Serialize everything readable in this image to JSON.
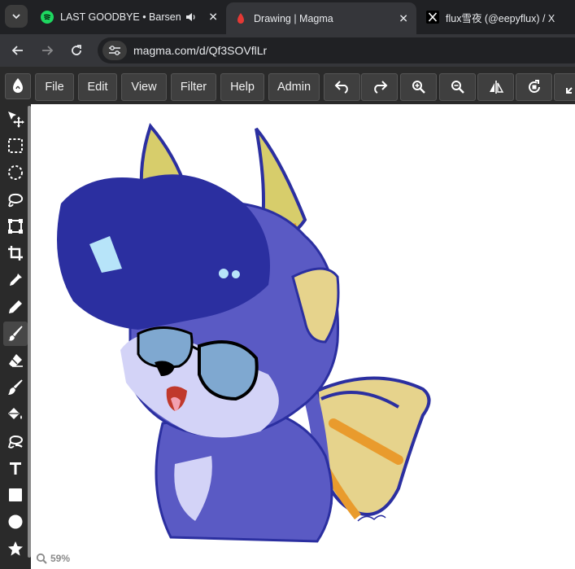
{
  "browser": {
    "tabs": [
      {
        "title": "LAST GOODBYE • Barsena B",
        "favicon": "spotify-icon",
        "audio": true
      },
      {
        "title": "Drawing | Magma",
        "favicon": "magma-icon",
        "active": true
      },
      {
        "title": "flux雪夜 (@eepyflux) / X",
        "favicon": "x-icon"
      }
    ],
    "url": "magma.com/d/Qf3SOVflLr"
  },
  "app": {
    "menu": {
      "file": "File",
      "edit": "Edit",
      "view": "View",
      "filter": "Filter",
      "help": "Help",
      "admin": "Admin"
    },
    "toolbar_icons": [
      "undo-icon",
      "redo-icon",
      "zoom-in-icon",
      "zoom-out-icon",
      "flip-icon",
      "rotate-icon",
      "fullscreen-icon"
    ],
    "tools": [
      "move-tool",
      "rectangle-select-tool",
      "ellipse-select-tool",
      "lasso-tool",
      "transform-tool",
      "crop-tool",
      "eyedropper-tool",
      "pencil-tool",
      "brush-tool",
      "eraser-tool",
      "smudge-tool",
      "fill-tool",
      "text-tool",
      "rectangle-tool",
      "ellipse-tool",
      "shape-tool"
    ],
    "active_tool": "brush-tool",
    "zoom": "59%"
  },
  "colors": {
    "chrome_bg": "#202124",
    "chrome_active": "#35363a",
    "app_bg": "#2a2a2a",
    "button_bg": "#3f3f3f",
    "canvas_bg": "#ffffff",
    "hair": "#2b2fa0",
    "fur": "#5a5ac4",
    "muzzle": "#d3d3f7",
    "horn": "#d7cd6b",
    "wing": "#e6d38c",
    "orange": "#e99b2d"
  }
}
